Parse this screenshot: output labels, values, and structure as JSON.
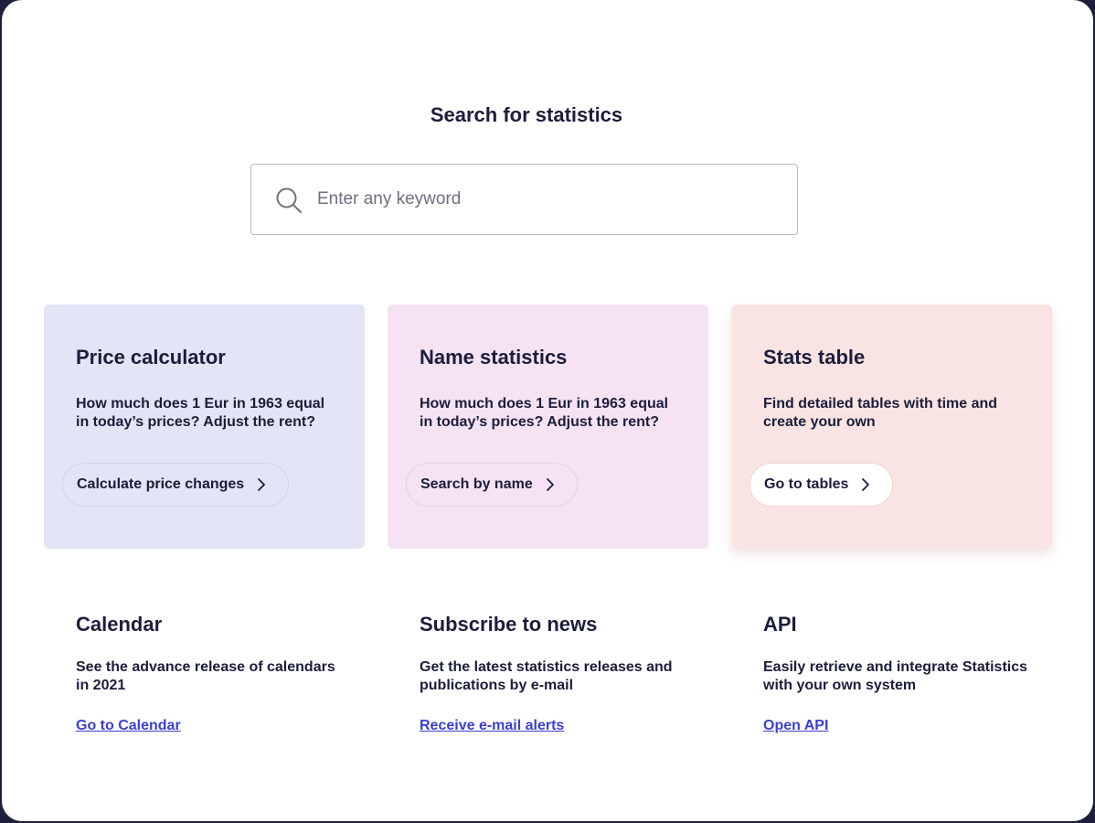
{
  "search": {
    "title": "Search for statistics",
    "placeholder": "Enter any keyword"
  },
  "cards": [
    {
      "title": "Price calculator",
      "description": "How much does 1 Eur in 1963 equal in today’s prices? Adjust the rent?",
      "button": "Calculate price changes",
      "background": "#e3e4f6"
    },
    {
      "title": "Name statistics",
      "description": "How much does 1 Eur in 1963 equal in today’s prices? Adjust the rent?",
      "button": "Search by name",
      "background": "#f5e2f3"
    },
    {
      "title": "Stats table",
      "description": "Find detailed tables with time and create your own",
      "button": "Go to tables",
      "background": "#f9e4e3"
    }
  ],
  "links": [
    {
      "title": "Calendar",
      "description": "See the advance release of calendars in 2021",
      "link": "Go to Calendar"
    },
    {
      "title": "Subscribe to news",
      "description": "Get the latest statistics releases and publications by e-mail",
      "link": "Receive e-mail alerts"
    },
    {
      "title": "API",
      "description": "Easily retrieve and integrate Statistics with your own system",
      "link": "Open API"
    }
  ],
  "colors": {
    "text": "#1c1d3b",
    "link": "#3b3fd1",
    "frame_border": "#1e1f3a"
  }
}
